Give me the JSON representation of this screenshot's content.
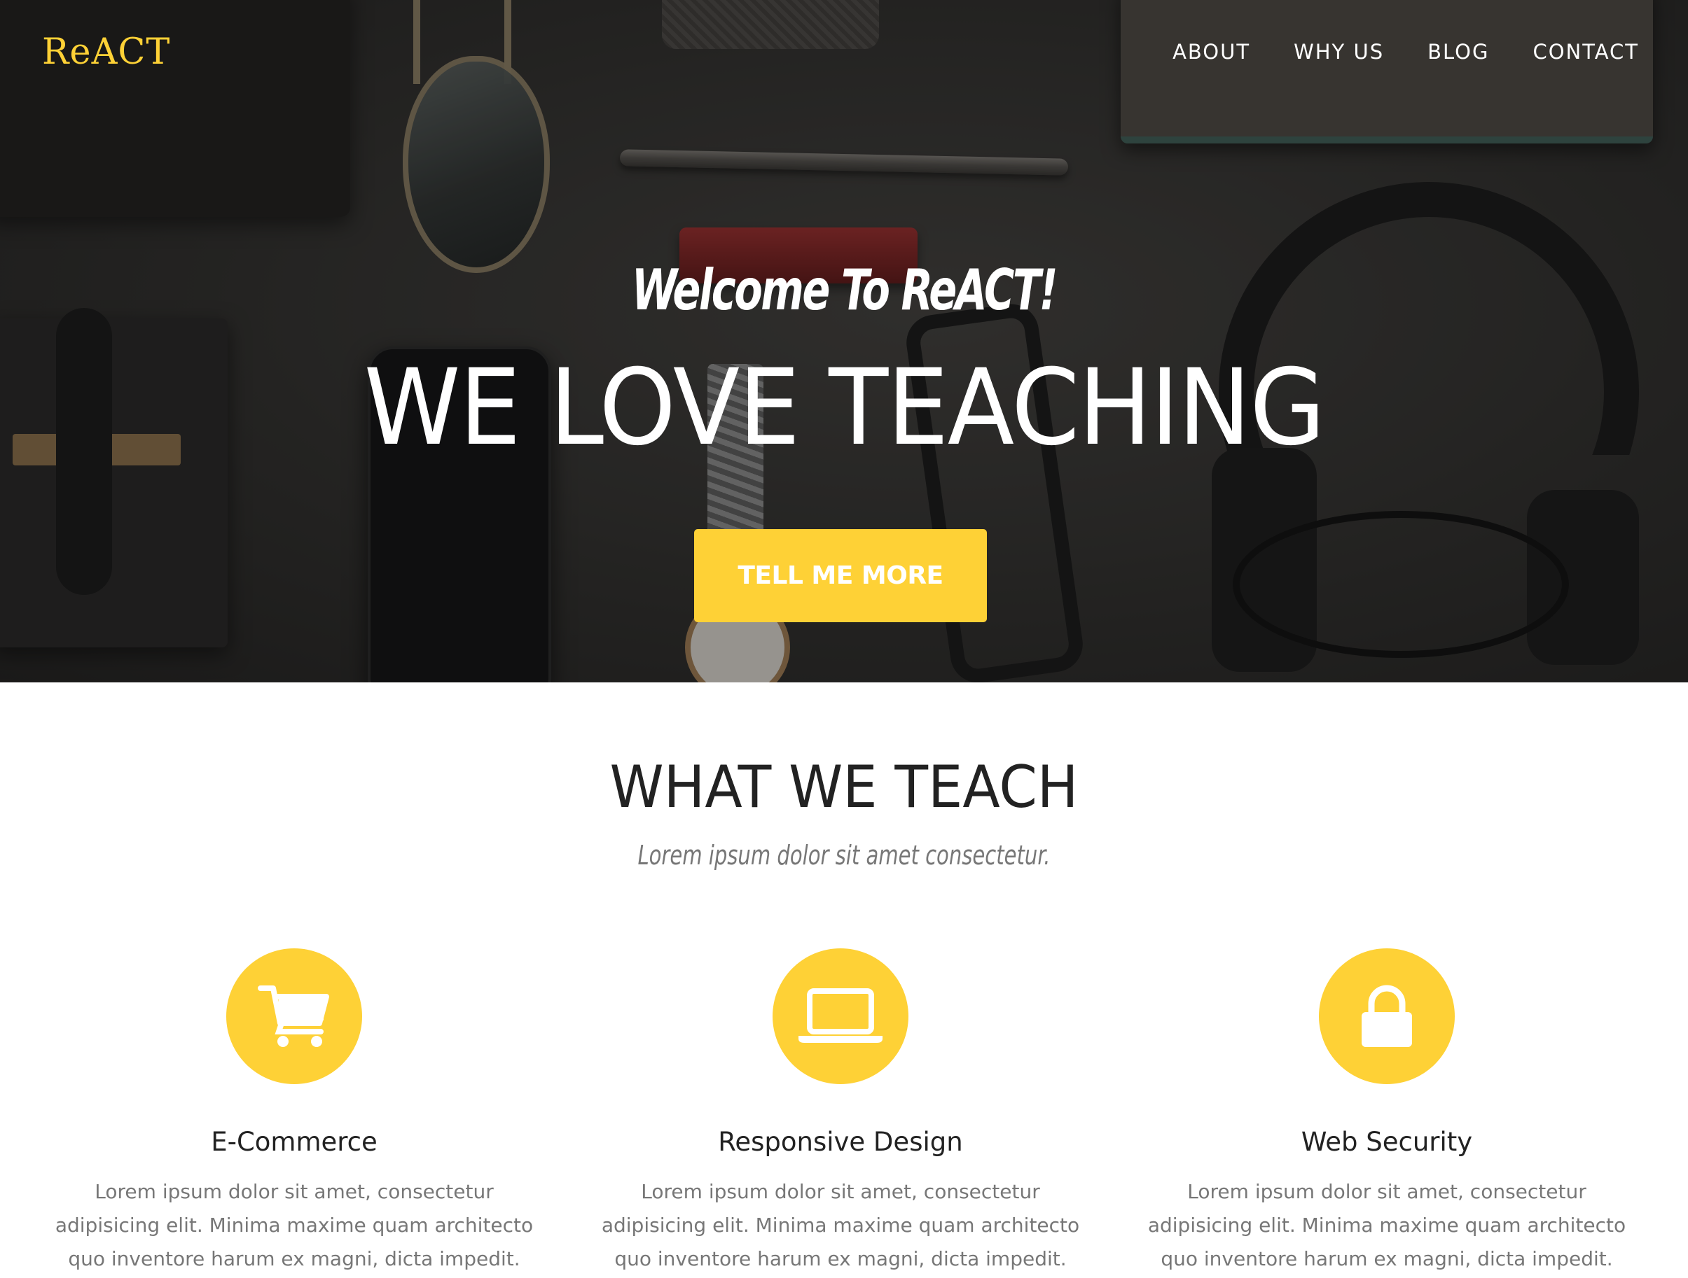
{
  "brand": {
    "logo": "ReACT",
    "accent_color": "#fed136"
  },
  "nav": {
    "items": [
      {
        "label": "ABOUT"
      },
      {
        "label": "WHY US"
      },
      {
        "label": "BLOG"
      },
      {
        "label": "CONTACT"
      }
    ]
  },
  "hero": {
    "subheading": "Welcome To ReACT!",
    "heading": "WE LOVE TEACHING",
    "cta_label": "TELL ME MORE"
  },
  "services": {
    "title": "WHAT WE TEACH",
    "subtitle": "Lorem ipsum dolor sit amet consectetur.",
    "items": [
      {
        "icon": "shopping-cart-icon",
        "title": "E-Commerce",
        "text": "Lorem ipsum dolor sit amet, consectetur adipisicing elit. Minima maxime quam architecto quo inventore harum ex magni, dicta impedit."
      },
      {
        "icon": "laptop-icon",
        "title": "Responsive Design",
        "text": "Lorem ipsum dolor sit amet, consectetur adipisicing elit. Minima maxime quam architecto quo inventore harum ex magni, dicta impedit."
      },
      {
        "icon": "lock-icon",
        "title": "Web Security",
        "text": "Lorem ipsum dolor sit amet, consectetur adipisicing elit. Minima maxime quam architecto quo inventore harum ex magni, dicta impedit."
      }
    ]
  }
}
